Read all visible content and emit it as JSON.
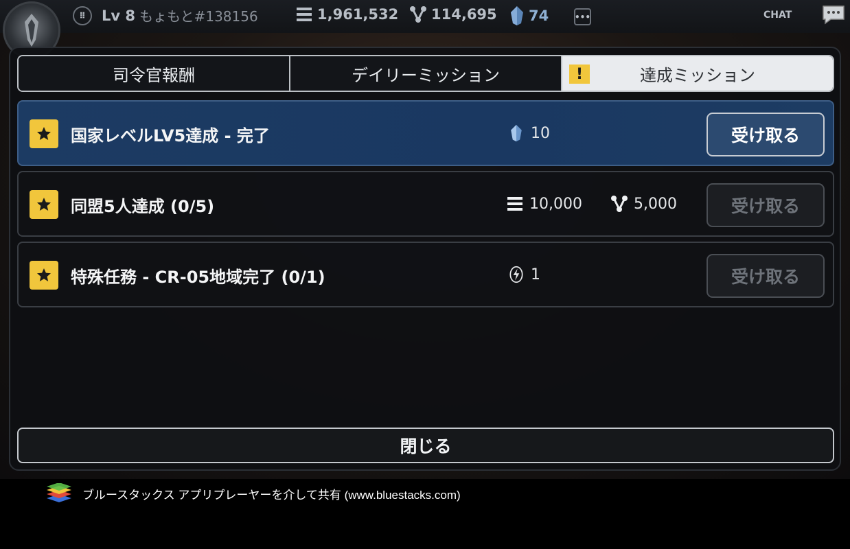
{
  "topbar": {
    "level": "Lv 8",
    "player_tag": "もょもと#138156",
    "resource_1": "1,961,532",
    "resource_2": "114,695",
    "gems": "74",
    "chat_label": "CHAT"
  },
  "tabs": [
    {
      "label": "司令官報酬",
      "active": false
    },
    {
      "label": "デイリーミッション",
      "active": false
    },
    {
      "label": "達成ミッション",
      "active": true,
      "alert": "!"
    }
  ],
  "missions": [
    {
      "title": "国家レベルLV5達成 - 完了",
      "rewards": [
        {
          "icon": "crystal-icon",
          "amount": "10"
        }
      ],
      "claim_label": "受け取る",
      "claimable": true
    },
    {
      "title": "同盟5人達成 (0/5)",
      "rewards": [
        {
          "icon": "bars-icon",
          "amount": "10,000"
        },
        {
          "icon": "molecule-icon",
          "amount": "5,000"
        }
      ],
      "claim_label": "受け取る",
      "claimable": false
    },
    {
      "title": "特殊任務 - CR-05地域完了 (0/1)",
      "rewards": [
        {
          "icon": "energy-icon",
          "amount": "1"
        }
      ],
      "claim_label": "受け取る",
      "claimable": false
    }
  ],
  "close_label": "閉じる",
  "footer": {
    "text": "ブルースタックス アプリプレーヤーを介して共有 (www.bluestacks.com)"
  },
  "colors": {
    "accent_yellow": "#f1c63c",
    "completed_row": "#1c3b63",
    "claim_enabled": "#2c4a70"
  }
}
